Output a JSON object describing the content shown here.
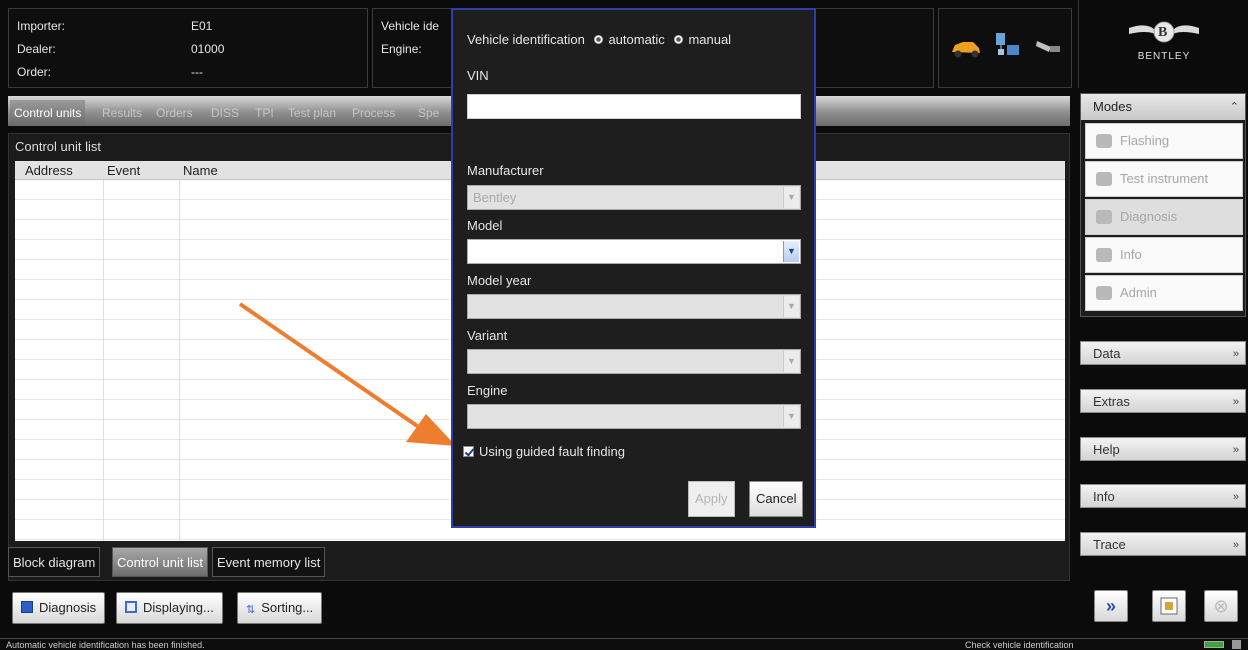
{
  "header": {
    "importer_label": "Importer:",
    "importer_value": "E01",
    "dealer_label": "Dealer:",
    "dealer_value": "01000",
    "order_label": "Order:",
    "order_value": "---",
    "vehicle_label": "Vehicle ide",
    "engine_label": "Engine:",
    "icons": [
      "car-icon",
      "network-icon",
      "plug-icon"
    ]
  },
  "brand": {
    "name": "BENTLEY",
    "badge": "B"
  },
  "tabs": [
    "Control units",
    "Results",
    "Orders",
    "DISS",
    "TPI",
    "Test plan",
    "Process",
    "Spe"
  ],
  "main": {
    "title": "Control unit list",
    "columns": [
      "Address",
      "Event",
      "Name"
    ]
  },
  "subtabs": [
    "Block diagram",
    "Control unit list",
    "Event memory list"
  ],
  "buttons": {
    "diagnosis": "Diagnosis",
    "displaying": "Displaying...",
    "sorting": "Sorting..."
  },
  "status": {
    "left": "Automatic vehicle identification has been finished.",
    "right": "Check vehicle identification"
  },
  "modes": {
    "title": "Modes",
    "items": [
      "Flashing",
      "Test instrument",
      "Diagnosis",
      "Info",
      "Admin"
    ]
  },
  "sections": [
    "Data",
    "Extras",
    "Help",
    "Info",
    "Trace"
  ],
  "dialog": {
    "identification_label": "Vehicle identification",
    "opt_automatic": "automatic",
    "opt_manual": "manual",
    "vin_label": "VIN",
    "vin_value": "",
    "manufacturer_label": "Manufacturer",
    "manufacturer_value": "Bentley",
    "model_label": "Model",
    "model_value": "",
    "model_year_label": "Model year",
    "variant_label": "Variant",
    "engine_label": "Engine",
    "guided_label": "Using guided fault finding",
    "apply": "Apply",
    "cancel": "Cancel"
  },
  "colors": {
    "dialog_border": "#2c3ea8",
    "arrow": "#ee7d2f",
    "background": "#0b0b0b"
  }
}
